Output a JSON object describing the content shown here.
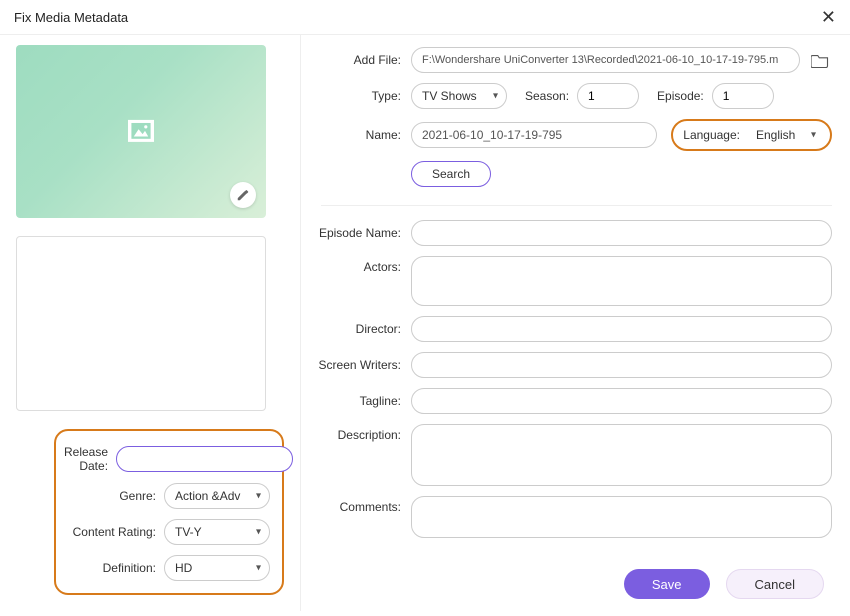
{
  "window": {
    "title": "Fix Media Metadata"
  },
  "left": {
    "release_date_label": "Release Date:",
    "release_date_value": "",
    "genre_label": "Genre:",
    "genre_value": "Action &Adv",
    "rating_label": "Content Rating:",
    "rating_value": "TV-Y",
    "definition_label": "Definition:",
    "definition_value": "HD"
  },
  "top": {
    "add_file_label": "Add File:",
    "add_file_value": "F:\\Wondershare UniConverter 13\\Recorded\\2021-06-10_10-17-19-795.m",
    "type_label": "Type:",
    "type_value": "TV Shows",
    "season_label": "Season:",
    "season_value": "1",
    "episode_label": "Episode:",
    "episode_value": "1",
    "name_label": "Name:",
    "name_value": "2021-06-10_10-17-19-795",
    "language_label": "Language:",
    "language_value": "English",
    "search_label": "Search"
  },
  "fields": {
    "episode_name_label": "Episode Name:",
    "actors_label": "Actors:",
    "director_label": "Director:",
    "screen_writers_label": "Screen Writers:",
    "tagline_label": "Tagline:",
    "description_label": "Description:",
    "comments_label": "Comments:"
  },
  "footer": {
    "save": "Save",
    "cancel": "Cancel"
  }
}
